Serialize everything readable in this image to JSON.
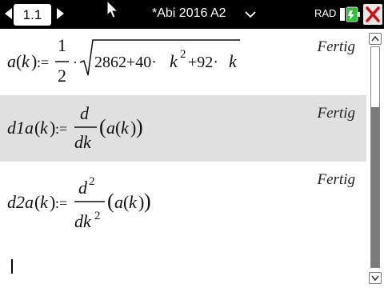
{
  "tab": {
    "label": "1.1"
  },
  "document": {
    "title": "*Abi 2016 A2"
  },
  "mode": "RAD",
  "rows": [
    {
      "status": "Fertig",
      "lhs": "a",
      "arg": "k",
      "assign": ":=",
      "frac_num": "1",
      "frac_den": "2",
      "mult": "·",
      "sqrt_a": "2862+40·",
      "var": "k",
      "exp": "2",
      "sqrt_b": "+92·",
      "var2": "k"
    },
    {
      "status": "Fertig",
      "lhs": "d1a",
      "arg": "k",
      "assign": ":=",
      "d": "d",
      "dk": "dk",
      "fn": "a",
      "fnarg": "k"
    },
    {
      "status": "Fertig",
      "lhs": "d2a",
      "arg": "k",
      "assign": ":=",
      "d": "d",
      "dexp": "2",
      "dk": "dk",
      "dkexp": "2",
      "fn": "a",
      "fnarg": "k"
    }
  ]
}
